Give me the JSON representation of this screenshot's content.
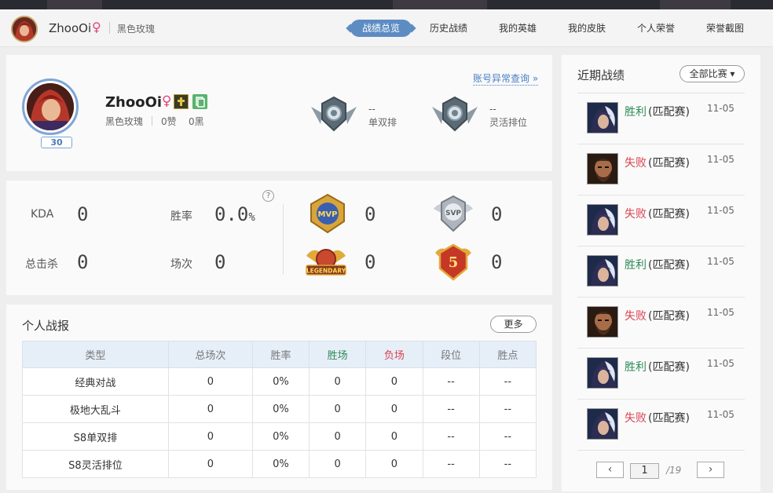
{
  "nav": {
    "name": "ZhooOi",
    "gender": "♀",
    "server": "黑色玫瑰",
    "tabs": [
      "战绩总览",
      "历史战绩",
      "我的英雄",
      "我的皮肤",
      "个人荣誉",
      "荣誉截图"
    ]
  },
  "profile": {
    "name": "ZhooOi",
    "gender": "♀",
    "level": "30",
    "server": "黑色玫瑰",
    "likes": "0赞",
    "blacks": "0黑",
    "abnormal_link": "账号异常查询 »",
    "ranks": [
      {
        "value": "--",
        "label": "单双排"
      },
      {
        "value": "--",
        "label": "灵活排位"
      }
    ]
  },
  "stats": {
    "help": "?",
    "kda_label": "KDA",
    "kda": "0",
    "winrate_label": "胜率",
    "winrate": "0.0",
    "winrate_unit": "%",
    "kills_label": "总击杀",
    "kills": "0",
    "games_label": "场次",
    "games": "0",
    "medals": [
      {
        "name": "MVP",
        "value": "0"
      },
      {
        "name": "SVP",
        "value": "0"
      },
      {
        "name": "LEGENDARY",
        "value": "0"
      },
      {
        "name": "5",
        "value": "0"
      }
    ]
  },
  "report": {
    "title": "个人战报",
    "more": "更多",
    "headers": [
      "类型",
      "总场次",
      "胜率",
      "胜场",
      "负场",
      "段位",
      "胜点"
    ],
    "rows": [
      [
        "经典对战",
        "0",
        "0%",
        "0",
        "0",
        "--",
        "--"
      ],
      [
        "极地大乱斗",
        "0",
        "0%",
        "0",
        "0",
        "--",
        "--"
      ],
      [
        "S8单双排",
        "0",
        "0%",
        "0",
        "0",
        "--",
        "--"
      ],
      [
        "S8灵活排位",
        "0",
        "0%",
        "0",
        "0",
        "--",
        "--"
      ]
    ]
  },
  "recent": {
    "title": "近期战绩",
    "filter": "全部比赛 ▾",
    "items": [
      {
        "result": "胜利",
        "outcome": "win",
        "mode": "(匹配赛)",
        "date": "11-05",
        "hero": "dark-haired-champion-icon"
      },
      {
        "result": "失败",
        "outcome": "loss",
        "mode": "(匹配赛)",
        "date": "11-05",
        "hero": "bearded-champion-icon"
      },
      {
        "result": "失败",
        "outcome": "loss",
        "mode": "(匹配赛)",
        "date": "11-05",
        "hero": "dark-haired-champion-icon"
      },
      {
        "result": "胜利",
        "outcome": "win",
        "mode": "(匹配赛)",
        "date": "11-05",
        "hero": "dark-haired-champion-icon"
      },
      {
        "result": "失败",
        "outcome": "loss",
        "mode": "(匹配赛)",
        "date": "11-05",
        "hero": "bearded-champion-icon"
      },
      {
        "result": "胜利",
        "outcome": "win",
        "mode": "(匹配赛)",
        "date": "11-05",
        "hero": "dark-haired-champion-icon"
      },
      {
        "result": "失败",
        "outcome": "loss",
        "mode": "(匹配赛)",
        "date": "11-05",
        "hero": "dark-haired-champion-icon"
      }
    ],
    "pagination": {
      "prev": "‹",
      "current": "1",
      "total": "/19",
      "next": "›"
    }
  },
  "colors": {
    "win": "#2e8b57",
    "loss": "#d9434f",
    "accent": "#5d8cc3",
    "link": "#4a7fc1"
  }
}
